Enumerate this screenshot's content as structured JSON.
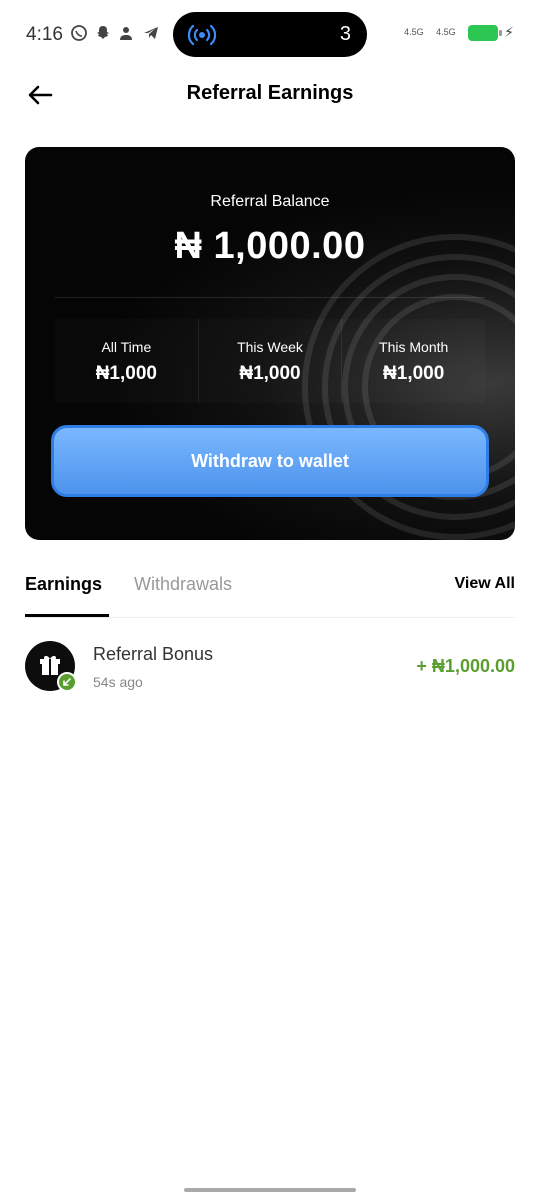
{
  "status_bar": {
    "time": "4:16",
    "notification_count": "3",
    "signal_1": "4.5G",
    "signal_2": "4.5G",
    "icons": [
      "whatsapp-icon",
      "snapchat-icon",
      "contacts-icon",
      "telegram-icon"
    ],
    "battery_color": "#2dc653"
  },
  "header": {
    "title": "Referral Earnings"
  },
  "balance_card": {
    "label": "Referral Balance",
    "amount": "₦ 1,000.00",
    "stats": [
      {
        "label": "All Time",
        "value": "₦1,000"
      },
      {
        "label": "This Week",
        "value": "₦1,000"
      },
      {
        "label": "This Month",
        "value": "₦1,000"
      }
    ],
    "withdraw_label": "Withdraw to wallet"
  },
  "tabs": {
    "earnings": "Earnings",
    "withdrawals": "Withdrawals",
    "active": "Earnings",
    "view_all": "View All"
  },
  "transactions": [
    {
      "title": "Referral Bonus",
      "time": "54s ago",
      "amount": "+ ₦1,000.00",
      "icon": "gift-icon",
      "badge_icon": "arrow-down-left-icon"
    }
  ],
  "colors": {
    "accent_blue": "#4d93ec",
    "success_green": "#5a9e2f",
    "card_bg": "#000000"
  }
}
